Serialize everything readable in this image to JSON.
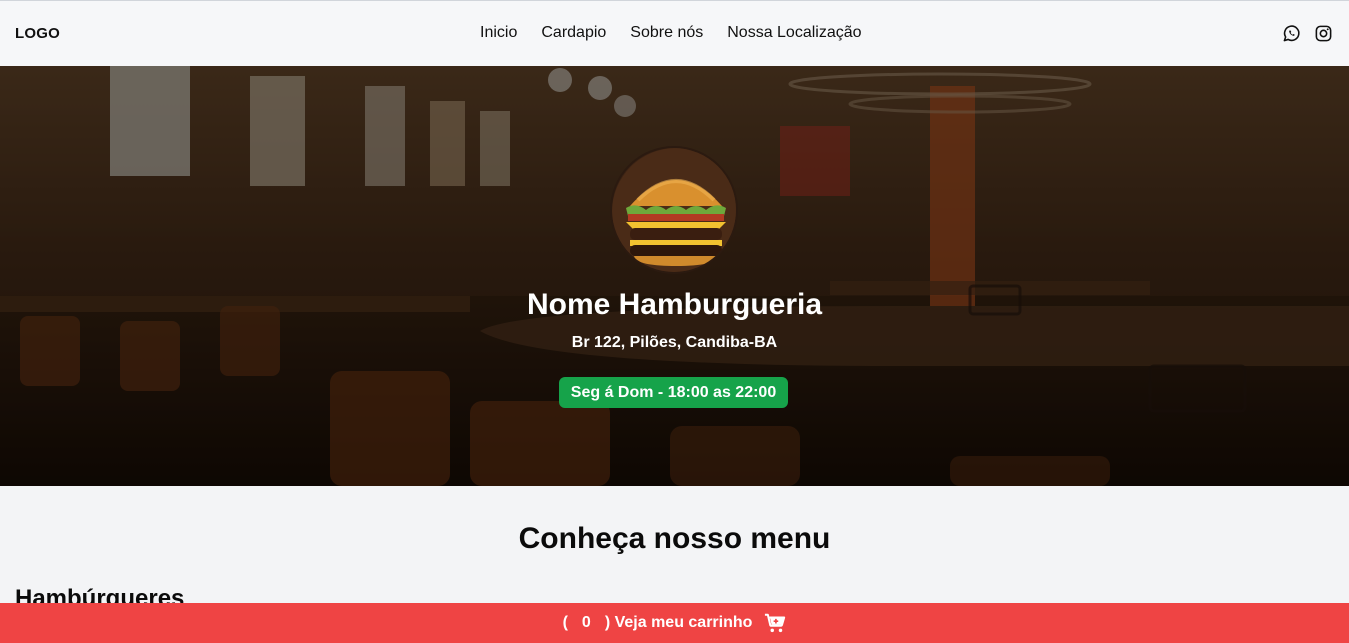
{
  "header": {
    "logo": "LOGO",
    "nav": [
      "Inicio",
      "Cardapio",
      "Sobre nós",
      "Nossa Localização"
    ],
    "social_icons": [
      "whatsapp-icon",
      "instagram-icon"
    ]
  },
  "hero": {
    "title": "Nome Hamburgueria",
    "address": "Br 122, Pilões, Candiba-BA",
    "hours": "Seg á Dom - 18:00 as 22:00",
    "hours_color": "#16a34a"
  },
  "menu": {
    "title": "Conheça nosso menu",
    "category": "Hambúrgueres"
  },
  "cart": {
    "open_paren": "(",
    "count": "0",
    "close_label": ") Veja meu carrinho",
    "icon": "shopping-cart-icon",
    "color": "#ef4444"
  }
}
